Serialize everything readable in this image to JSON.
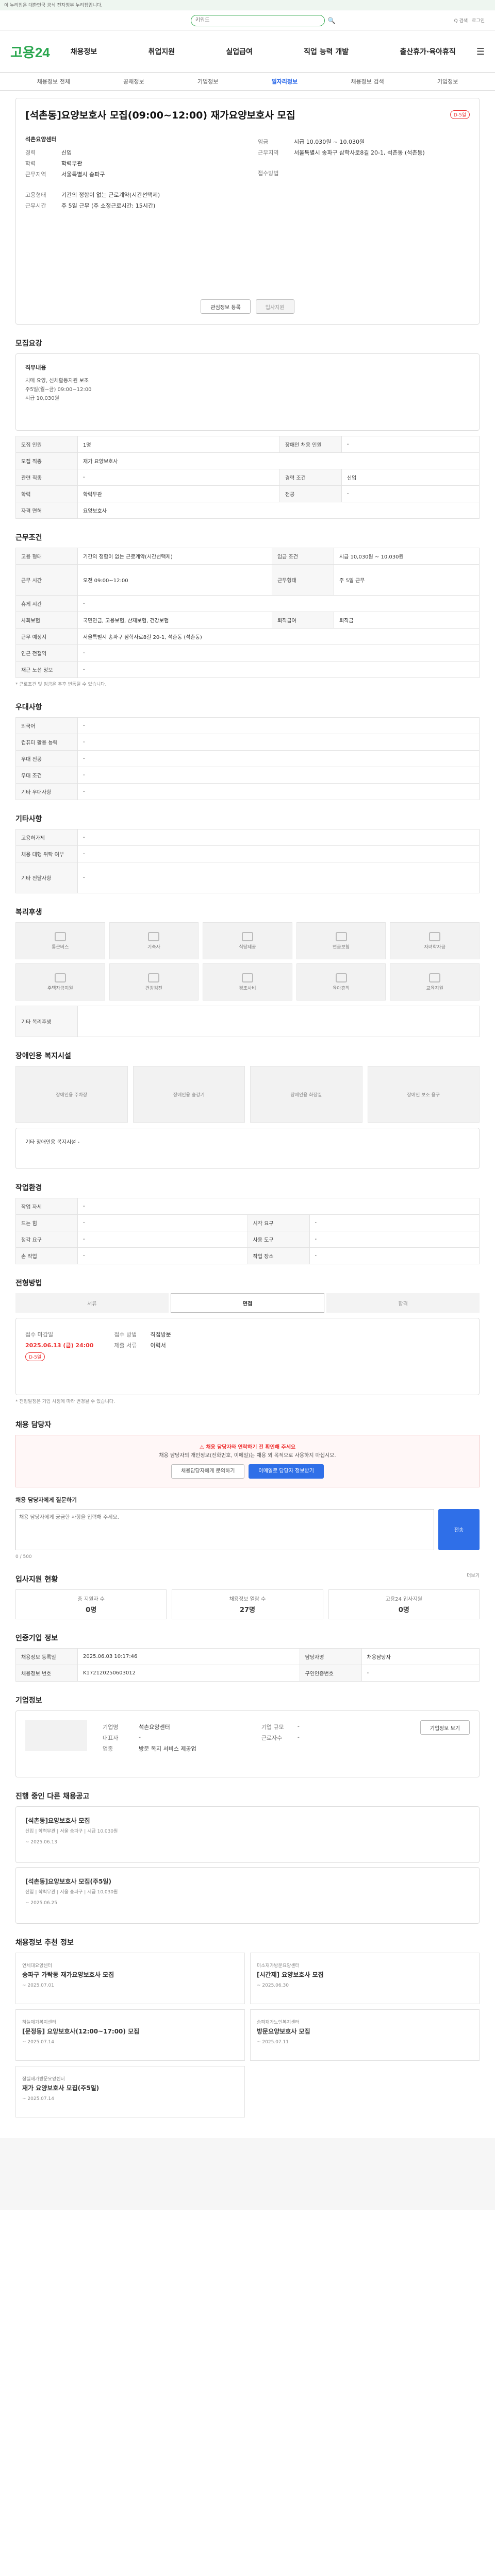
{
  "banner": {
    "text": "이 누리집은 대한민국 공식 전자정부 누리집입니다."
  },
  "top": {
    "search_placeholder": "키워드",
    "search_btn": "검색",
    "link1": "Q 검색",
    "link2": "로그인"
  },
  "logo": "고용24",
  "gnb": [
    "채용정보",
    "취업지원",
    "실업급여",
    "직업 능력 개발",
    "출산휴가·육아휴직"
  ],
  "subnav": [
    "채용정보 전체",
    "공채정보",
    "기업정보",
    "일자리정보",
    "채용정보 검색",
    "기업정보"
  ],
  "job": {
    "badge": "D-5일",
    "title": "[석촌동]요양보호사 모집(09:00~12:00) 재가요양보호사 모집",
    "center": "석촌요양센터",
    "location_h": "근무지역",
    "location": "서울특별시 송파구",
    "career_h": "경력",
    "career": "신입",
    "edu_h": "학력",
    "edu": "학력무관",
    "pay_h": "임금",
    "pay": "시급 10,030원 ~ 10,030원",
    "emp_h": "고용형태",
    "emp": "기간의 정함이 없는 근로계약(시간선택제)",
    "time_h": "근무시간",
    "time": "주 5일 근무 (주 소정근로시간: 15시간)",
    "area_h": "근무지역",
    "area": "서울특별시 송파구 삼학사로8길 20-1, 석촌동 (석촌동)",
    "apply_h": "접수방법",
    "apply": "",
    "btn_interest": "관심정보 등록",
    "btn_apply": "입사지원"
  },
  "recruit": {
    "title": "모집요강",
    "subtitle": "직무내용",
    "desc1": "치매 요양, 신체활동지원 보조",
    "desc2": "주5일(월~금) 09:00~12:00",
    "desc3": "시급 10,030원",
    "rows": [
      [
        "모집 인원",
        "1명",
        "장애인 채용 인원",
        "-"
      ],
      [
        "모집 직종",
        "재가 요양보호사",
        "",
        ""
      ],
      [
        "관련 직종",
        "-",
        "경력 조건",
        "신입"
      ],
      [
        "학력",
        "학력무관",
        "전공",
        "-"
      ],
      [
        "자격 면허",
        "요양보호사",
        "",
        ""
      ]
    ]
  },
  "cond": {
    "title": "근무조건",
    "rows": [
      [
        "고용 형태",
        "기간의 정함이 없는 근로계약(시간선택제)",
        "임금 조건",
        "시급 10,030원 ~ 10,030원"
      ],
      [
        "근무 시간",
        "오전 09:00~12:00",
        "근무형태",
        "주 5일 근무"
      ],
      [
        "휴게 시간",
        "-",
        "",
        ""
      ],
      [
        "사회보험",
        "국민연금, 고용보험, 산재보험, 건강보험",
        "퇴직급여",
        "퇴직금"
      ],
      [
        "근무 예정지",
        "서울특별시 송파구 삼학사로8길 20-1, 석촌동 (석촌동)",
        "",
        ""
      ],
      [
        "인근 전철역",
        "-",
        "",
        ""
      ],
      [
        "재근 노선 정보",
        "-",
        "",
        ""
      ]
    ],
    "note": "* 근로조건 및 임금은 추후 변동될 수 있습니다."
  },
  "prefer": {
    "title": "우대사항",
    "rows": [
      [
        "외국어",
        "-"
      ],
      [
        "컴퓨터 활용 능력",
        "-"
      ],
      [
        "우대 전공",
        "-"
      ],
      [
        "우대 조건",
        "-"
      ],
      [
        "기타 우대사항",
        "-"
      ]
    ]
  },
  "etc": {
    "title": "기타사항",
    "rows": [
      [
        "고용허가제",
        "-"
      ],
      [
        "채용 대행 위탁 여부",
        "-"
      ],
      [
        "기타 전달사항",
        "-"
      ]
    ]
  },
  "welfare": {
    "title": "복리후생",
    "tiles": [
      "통근버스",
      "기숙사",
      "식당제공",
      "연금보험",
      "자녀학자금",
      "주택자금지원",
      "건강검진",
      "경조사비",
      "육아휴직",
      "교육지원"
    ],
    "note": "기타 복리후생"
  },
  "disabled": {
    "title": "장애인용 복지시설",
    "tiles": [
      "장애인용 주차장",
      "장애인용 승강기",
      "장애인용 화장실",
      "장애인 보조 용구"
    ],
    "note": "기타 장애인용 복지시설 -"
  },
  "workenv": {
    "title": "작업환경",
    "rows": [
      [
        "작업 자세",
        "-",
        "",
        ""
      ],
      [
        "드는 힘",
        "-",
        "시각 요구",
        "-"
      ],
      [
        "청각 요구",
        "-",
        "사용 도구",
        "-"
      ],
      [
        "손 작업",
        "-",
        "작업 장소",
        "-"
      ]
    ]
  },
  "process": {
    "title": "전형방법",
    "steps": [
      "서류",
      "면접",
      "합격"
    ],
    "deadline_h": "접수 마감일",
    "deadline": "2025.06.13 (금) 24:00",
    "badge": "D-5일",
    "method_h": "접수 방법",
    "method": "직접방문",
    "docs_h": "제출 서류",
    "docs": "이력서",
    "notes": [
      "* 전형일정은 기업 사정에 따라 변경될 수 있습니다."
    ]
  },
  "contact": {
    "title": "채용 담당자",
    "msg1": "채용 담당자와 연락하기 전 확인해 주세요",
    "msg2": "채용 담당자의 개인정보(전화번호, 이메일)는 채용 외 목적으로 사용하지 마십시오.",
    "btn1": "채용담당자에게 문의하기",
    "btn2": "이메일로 담당자 정보받기",
    "sub": "채용 담당자에게 질문하기",
    "placeholder": "채용 담당자에게 궁금한 사항을 입력해 주세요.",
    "send": "전송",
    "count": "0 / 500"
  },
  "history": {
    "title": "입사지원 현황",
    "more": "더보기",
    "cells": [
      [
        "총 지원자 수",
        "0명"
      ],
      [
        "채용정보 열람 수",
        "27명"
      ],
      [
        "고용24 입사지원",
        "0명"
      ]
    ]
  },
  "info": {
    "title": "인증기업 정보",
    "rows": [
      [
        "채용정보 등록일",
        "2025.06.03 10:17:46",
        "담당자명",
        "채용담당자"
      ],
      [
        "채용정보 번호",
        "K172120250603012",
        "구인인증번호",
        "-"
      ]
    ]
  },
  "company": {
    "title": "기업정보",
    "name_h": "기업명",
    "name": "석촌요양센터",
    "ceo_h": "대표자",
    "ceo": "-",
    "ind_h": "업종",
    "ind": "방문 복지 서비스 제공업",
    "size_h": "기업 규모",
    "size": "-",
    "emp_h": "근로자수",
    "emp": "-",
    "btn": "기업정보 보기"
  },
  "others": {
    "title": "진행 중인 다른 채용공고",
    "items": [
      {
        "title": "[석촌동]요양보호사 모집",
        "meta": "신입 | 학력무관 | 서울 송파구 | 시급 10,030원",
        "date": "~ 2025.06.13"
      },
      {
        "title": "[석촌동]요양보호사 모집(주5일)",
        "meta": "신입 | 학력무관 | 서울 송파구 | 시급 10,030원",
        "date": "~ 2025.06.25"
      }
    ]
  },
  "recs": {
    "title": "채용정보 추천 정보",
    "items": [
      {
        "co": "연세대요양센터",
        "t": "송파구 가락동 재가요양보호사 모집",
        "d": "~ 2025.07.01"
      },
      {
        "co": "미소재가방문요양센터",
        "t": "[시간제] 요양보호사 모집",
        "d": "~ 2025.06.30"
      },
      {
        "co": "하늘재가복지센터",
        "t": "[문정동] 요양보호사(12:00~17:00) 모집",
        "d": "~ 2025.07.14"
      },
      {
        "co": "송파재가노인복지센터",
        "t": "방문요양보호사 모집",
        "d": "~ 2025.07.11"
      },
      {
        "co": "잠실재가방문요양센터",
        "t": "재가 요양보호사 모집(주5일)",
        "d": "~ 2025.07.14"
      }
    ]
  }
}
